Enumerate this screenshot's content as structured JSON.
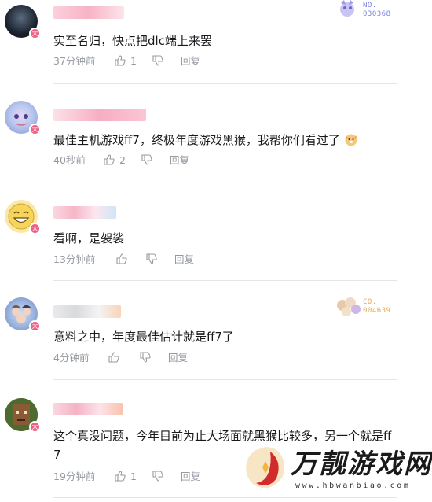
{
  "comments": [
    {
      "text": "实至名归，快点把dlc端上来罢",
      "time": "37分钟前",
      "likes": "1",
      "reply": "回复",
      "medal": {
        "label": "NO.",
        "number": "030368",
        "color": "#7b7fe0"
      }
    },
    {
      "text": "最佳主机游戏ff7，终极年度游戏黑猴，我帮你们看过了",
      "time": "40秒前",
      "likes": "2",
      "reply": "回复"
    },
    {
      "text": "看啊，是袈裟",
      "time": "13分钟前",
      "likes": "",
      "reply": "回复"
    },
    {
      "text": "意料之中，年度最佳估计就是ff7了",
      "time": "4分钟前",
      "likes": "",
      "reply": "回复",
      "medal": {
        "label": "CO.",
        "number": "004639",
        "color": "#e0a94a"
      }
    },
    {
      "text_line1": "这个真没问题，今年目前为止大场面就黑猴比较多，另一个就是ff",
      "text_line2": "7",
      "time": "19分钟前",
      "likes": "1",
      "reply": "回复"
    }
  ],
  "watermark": {
    "title": "万靓游戏网",
    "url": "www.hbwanbiao.com"
  },
  "colors": {
    "text": "#18191c",
    "meta": "#9499a0",
    "badge": "#ee5f86"
  }
}
